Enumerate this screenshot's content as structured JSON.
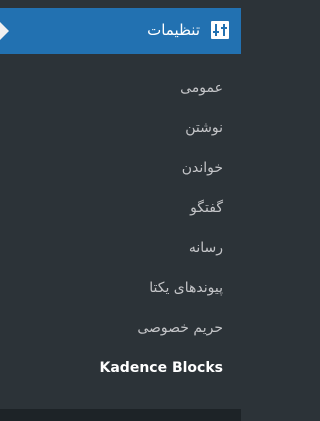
{
  "menu": {
    "title": "تنظیمات",
    "icon": "settings-sliders-icon",
    "items": [
      {
        "label": "عمومی"
      },
      {
        "label": "نوشتن"
      },
      {
        "label": "خواندن"
      },
      {
        "label": "گفتگو"
      },
      {
        "label": "رسانه"
      },
      {
        "label": "پیوندهای یکتا"
      },
      {
        "label": "حریم خصوصی"
      },
      {
        "label": "Kadence Blocks",
        "current": true
      }
    ]
  },
  "colors": {
    "accent": "#2271b1",
    "background": "#2c3338",
    "text": "#c3c4c7",
    "active_text": "#ffffff"
  }
}
